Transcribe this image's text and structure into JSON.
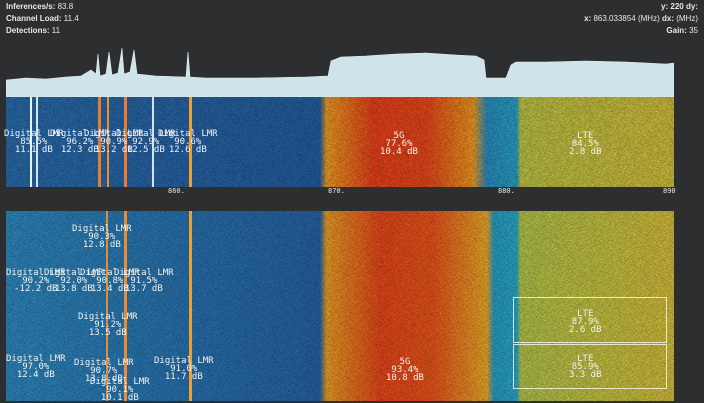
{
  "hud": {
    "inferences_label": "Inferences/s:",
    "inferences_value": "83.8",
    "channel_load_label": "Channel Load:",
    "channel_load_value": "11.4",
    "detections_label": "Detections:",
    "detections_value": "11",
    "y_label": "y:",
    "y_value": "220",
    "dy_label": "dy:",
    "x_label": "x:",
    "x_value": "863.033854 (MHz)",
    "dx_label": "dx:",
    "dx_value": "(MHz)",
    "gain_label": "Gain:",
    "gain_value": "35"
  },
  "axis": {
    "ticks": [
      "860.",
      "870.",
      "880.",
      "890"
    ]
  },
  "colors": {
    "background": "#2d2e30",
    "spectrum_fill": "#cfe3ea",
    "label_text": "#f2f2f2"
  },
  "waterfall_top": {
    "detections": [
      {
        "name": "Digital LMR",
        "conf": "85.5%",
        "snr": "11.1 dB"
      },
      {
        "name": "Digital LMR",
        "conf": "96.2%",
        "snr": "12.3 dB"
      },
      {
        "name": "Digital LMR",
        "conf": "90.9%",
        "snr": "13.2 dB"
      },
      {
        "name": "Digital LMR",
        "conf": "92.9%",
        "snr": "12.5 dB"
      },
      {
        "name": "Digital LMR",
        "conf": "90.6%",
        "snr": "12.6 dB"
      },
      {
        "name": "5G",
        "conf": "77.6%",
        "snr": "10.4 dB"
      },
      {
        "name": "LTE",
        "conf": "84.5%",
        "snr": "2.8 dB"
      }
    ]
  },
  "waterfall_bottom": {
    "detections": [
      {
        "name": "Digital LMR",
        "conf": "90.3%",
        "snr": "12.8 dB"
      },
      {
        "name": "Digital LMR",
        "conf": "90.2%",
        "snr": "-12.2 dB"
      },
      {
        "name": "Digital LMR",
        "conf": "92.0%",
        "snr": "13.8 dB"
      },
      {
        "name": "Digital LMR",
        "conf": "90.8%",
        "snr": "13.4 dB"
      },
      {
        "name": "Digital LMR",
        "conf": "91.5%",
        "snr": "13.7 dB"
      },
      {
        "name": "Digital LMR",
        "conf": "91.2%",
        "snr": "13.5 dB"
      },
      {
        "name": "Digital LMR",
        "conf": "97.0%",
        "snr": "12.4 dB"
      },
      {
        "name": "Digital LMR",
        "conf": "90.7%",
        "snr": "13.8 dB"
      },
      {
        "name": "Digital LMR",
        "conf": "91.0%",
        "snr": "11.7 dB"
      },
      {
        "name": "Digital LMR",
        "conf": "90.1%",
        "snr": "10.1 dB"
      },
      {
        "name": "5G",
        "conf": "93.4%",
        "snr": "10.8 dB"
      },
      {
        "name": "LTE",
        "conf": "87.9%",
        "snr": "2.6 dB"
      },
      {
        "name": "LTE",
        "conf": "85.9%",
        "snr": "3.3 dB"
      }
    ]
  }
}
